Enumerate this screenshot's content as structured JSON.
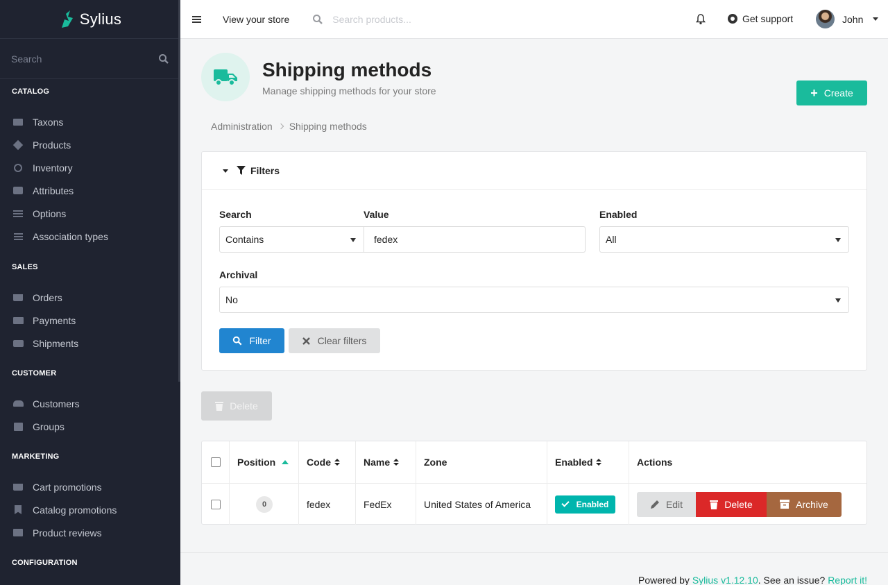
{
  "brand": {
    "name": "Sylius"
  },
  "sidebar": {
    "search_placeholder": "Search",
    "sections": [
      {
        "title": "CATALOG",
        "items": [
          {
            "label": "Taxons",
            "icon": "folder-icon"
          },
          {
            "label": "Products",
            "icon": "cube-icon"
          },
          {
            "label": "Inventory",
            "icon": "history-icon"
          },
          {
            "label": "Attributes",
            "icon": "cubes-icon"
          },
          {
            "label": "Options",
            "icon": "sliders-icon"
          },
          {
            "label": "Association types",
            "icon": "tasks-icon"
          }
        ]
      },
      {
        "title": "SALES",
        "items": [
          {
            "label": "Orders",
            "icon": "cart-icon"
          },
          {
            "label": "Payments",
            "icon": "payment-icon"
          },
          {
            "label": "Shipments",
            "icon": "truck-icon"
          }
        ]
      },
      {
        "title": "CUSTOMER",
        "items": [
          {
            "label": "Customers",
            "icon": "users-icon"
          },
          {
            "label": "Groups",
            "icon": "archive-icon"
          }
        ]
      },
      {
        "title": "MARKETING",
        "items": [
          {
            "label": "Cart promotions",
            "icon": "cart-icon"
          },
          {
            "label": "Catalog promotions",
            "icon": "bookmark-icon"
          },
          {
            "label": "Product reviews",
            "icon": "newspaper-icon"
          }
        ]
      },
      {
        "title": "CONFIGURATION",
        "items": []
      }
    ]
  },
  "topbar": {
    "view_store": "View your store",
    "search_placeholder": "Search products...",
    "support": "Get support",
    "user": "John"
  },
  "page": {
    "title": "Shipping methods",
    "subtitle": "Manage shipping methods for your store",
    "create_label": "Create",
    "breadcrumb": [
      "Administration",
      "Shipping methods"
    ]
  },
  "filters": {
    "header": "Filters",
    "search_label": "Search",
    "search_type": "Contains",
    "value_label": "Value",
    "value": "fedex",
    "enabled_label": "Enabled",
    "enabled_value": "All",
    "archival_label": "Archival",
    "archival_value": "No",
    "filter_button": "Filter",
    "clear_button": "Clear filters"
  },
  "bulk": {
    "delete_label": "Delete"
  },
  "table": {
    "columns": [
      "Position",
      "Code",
      "Name",
      "Zone",
      "Enabled",
      "Actions"
    ],
    "rows": [
      {
        "position": "0",
        "code": "fedex",
        "name": "FedEx",
        "zone": "United States of America",
        "enabled": "Enabled",
        "actions": {
          "edit": "Edit",
          "delete": "Delete",
          "archive": "Archive"
        }
      }
    ]
  },
  "footer": {
    "prefix": "Powered by ",
    "version_link": "Sylius v1.12.10",
    "middle": ". See an issue? ",
    "report_link": "Report it!"
  },
  "colors": {
    "accent": "#1abb9c",
    "sidebar_bg": "#1f2330",
    "primary": "#2185d0",
    "danger": "#db2828",
    "archive": "#a5673f",
    "enabled": "#00b5ad"
  }
}
